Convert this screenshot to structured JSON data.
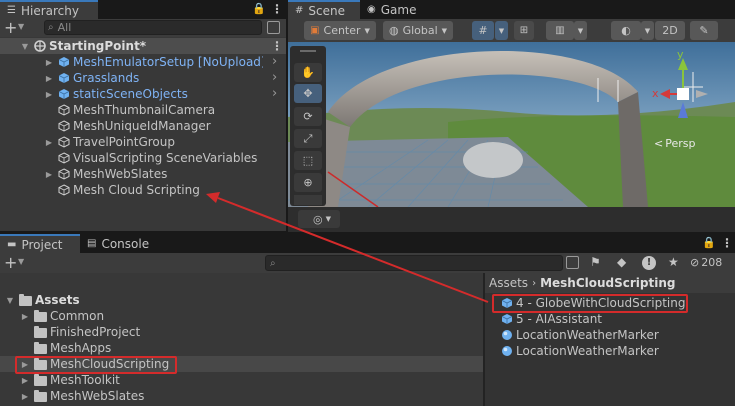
{
  "hierarchy": {
    "tab_label": "Hierarchy",
    "search_placeholder": "All",
    "scene_name": "StartingPoint*",
    "items": [
      {
        "label": "MeshEmulatorSetup [NoUpload]",
        "prefab": true
      },
      {
        "label": "Grasslands",
        "prefab": true
      },
      {
        "label": "staticSceneObjects",
        "prefab": true
      },
      {
        "label": "MeshThumbnailCamera",
        "prefab": false
      },
      {
        "label": "MeshUniqueIdManager",
        "prefab": false
      },
      {
        "label": "TravelPointGroup",
        "prefab": false
      },
      {
        "label": "VisualScripting SceneVariables",
        "prefab": false
      },
      {
        "label": "MeshWebSlates",
        "prefab": false
      },
      {
        "label": "Mesh Cloud Scripting",
        "prefab": false
      }
    ]
  },
  "scene": {
    "tab_scene": "Scene",
    "tab_game": "Game",
    "pivot_label": "Center",
    "space_label": "Global",
    "mode_2d": "2D",
    "persp_label": "Persp",
    "axis_x": "x",
    "axis_y": "y"
  },
  "project": {
    "tab_project": "Project",
    "tab_console": "Console",
    "hidden_count": "208",
    "tree": [
      {
        "label": "Assets",
        "bold": true,
        "expanded": true
      },
      {
        "label": "Common"
      },
      {
        "label": "FinishedProject"
      },
      {
        "label": "MeshApps"
      },
      {
        "label": "MeshCloudScripting"
      },
      {
        "label": "MeshToolkit"
      },
      {
        "label": "MeshWebSlates"
      }
    ],
    "breadcrumb_root": "Assets",
    "breadcrumb_current": "MeshCloudScripting",
    "assets": [
      {
        "label": "4 - GlobeWithCloudScripting",
        "icon": "prefab-icon"
      },
      {
        "label": "5 - AIAssistant",
        "icon": "prefab-icon"
      },
      {
        "label": "LocationWeatherMarker",
        "icon": "sphere-icon"
      },
      {
        "label": "LocationWeatherMarker",
        "icon": "sphere-icon"
      }
    ]
  },
  "colors": {
    "highlight": "#d42b2b",
    "accent": "#3a79bb",
    "prefab_text": "#7fb3f5"
  }
}
